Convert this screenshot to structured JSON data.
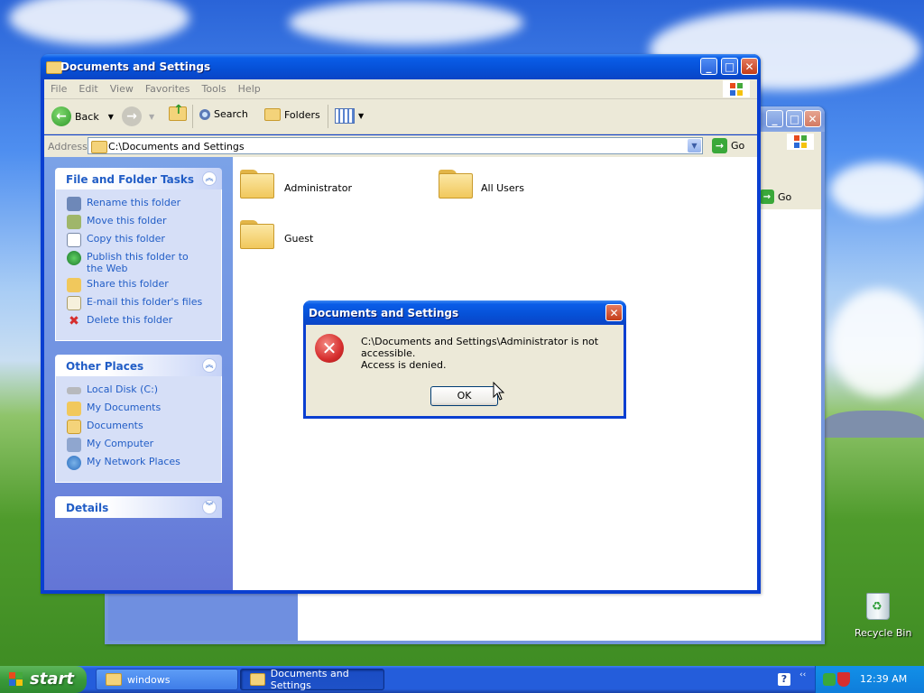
{
  "back_window": {
    "go_label": "Go"
  },
  "explorer": {
    "title": "Documents and Settings",
    "menu": [
      "File",
      "Edit",
      "View",
      "Favorites",
      "Tools",
      "Help"
    ],
    "toolbar": {
      "back": "Back",
      "search": "Search",
      "folders": "Folders"
    },
    "address": {
      "label": "Address",
      "value": "C:\\Documents and Settings",
      "go": "Go"
    },
    "tasks_panel": {
      "title": "File and Folder Tasks",
      "items": [
        "Rename this folder",
        "Move this folder",
        "Copy this folder",
        "Publish this folder to the Web",
        "Share this folder",
        "E-mail this folder's files",
        "Delete this folder"
      ]
    },
    "places_panel": {
      "title": "Other Places",
      "items": [
        "Local Disk (C:)",
        "My Documents",
        "Documents",
        "My Computer",
        "My Network Places"
      ]
    },
    "details_panel": {
      "title": "Details"
    },
    "folders": [
      "Administrator",
      "All Users",
      "Guest"
    ]
  },
  "dialog": {
    "title": "Documents and Settings",
    "message": "C:\\Documents and Settings\\Administrator is not accessible.",
    "detail": "Access is denied.",
    "ok": "OK"
  },
  "desktop": {
    "recycle_bin": "Recycle Bin"
  },
  "taskbar": {
    "start": "start",
    "buttons": [
      "windows",
      "Documents and Settings"
    ],
    "clock": "12:39 AM"
  },
  "colors": {
    "xp_blue": "#0a3fd1",
    "link_blue": "#215dc6",
    "error_red": "#d62e2e"
  }
}
